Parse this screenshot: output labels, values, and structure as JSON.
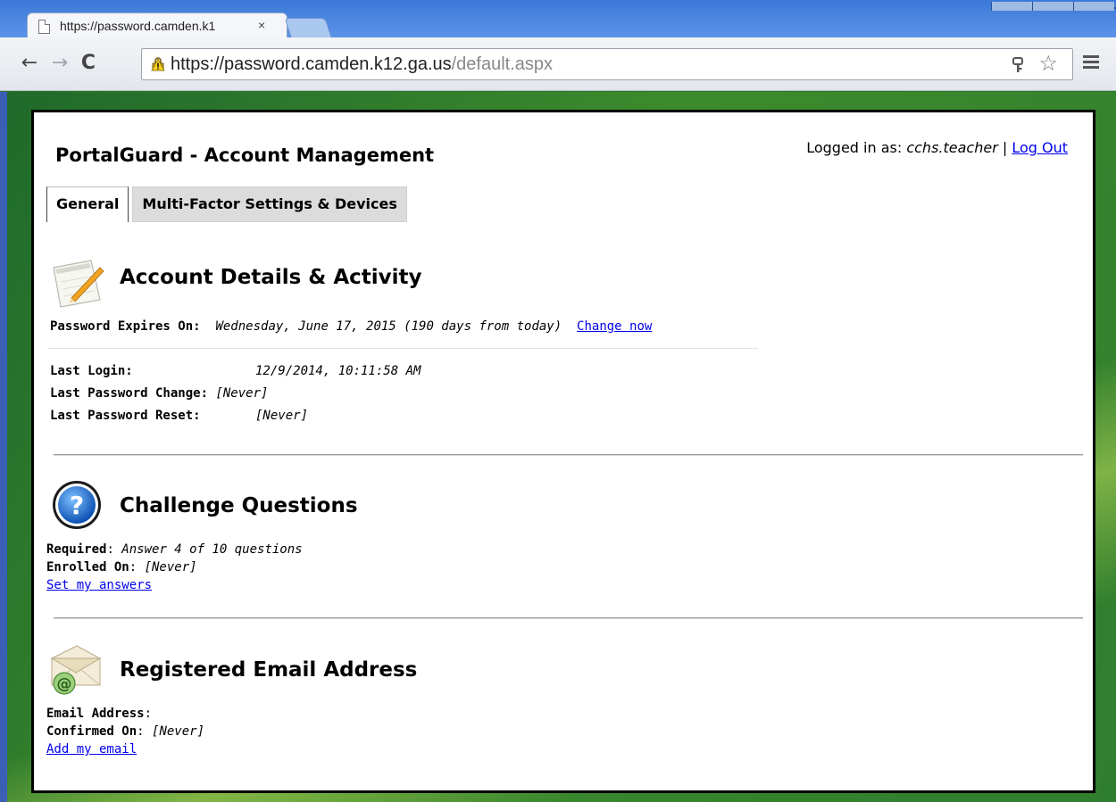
{
  "browser": {
    "tab_title": "https://password.camden.k1",
    "tab_close": "×",
    "url_main": "https://password.camden.k12.ga.us",
    "url_path": "/default.aspx",
    "nav_back": "←",
    "nav_forward": "→",
    "nav_reload": "C",
    "star": "☆"
  },
  "page": {
    "title": "PortalGuard - Account Management",
    "logged_prefix": "Logged in as: ",
    "username": "cchs.teacher",
    "separator": " | ",
    "logout": "Log Out",
    "tabs": [
      {
        "label": "General"
      },
      {
        "label": "Multi-Factor Settings & Devices"
      }
    ]
  },
  "account": {
    "title": "Account Details & Activity",
    "expires_label": "Password Expires On:",
    "expires_value": "Wednesday, June 17, 2015  (190 days from today)",
    "change_now": "Change now",
    "last_login_label": "Last Login:",
    "last_login_value": "12/9/2014, 10:11:58 AM",
    "last_change_label": "Last Password Change:",
    "last_change_value": "[Never]",
    "last_reset_label": "Last Password Reset:",
    "last_reset_value": "[Never]"
  },
  "challenge": {
    "title": "Challenge Questions",
    "required_label": "Required",
    "required_value": "Answer 4 of 10 questions",
    "enrolled_label": "Enrolled On",
    "enrolled_value": "[Never]",
    "link": "Set my answers"
  },
  "email": {
    "title": "Registered Email Address",
    "address_label": "Email Address",
    "address_value": "",
    "confirmed_label": "Confirmed On",
    "confirmed_value": "[Never]",
    "link": "Add my email"
  }
}
